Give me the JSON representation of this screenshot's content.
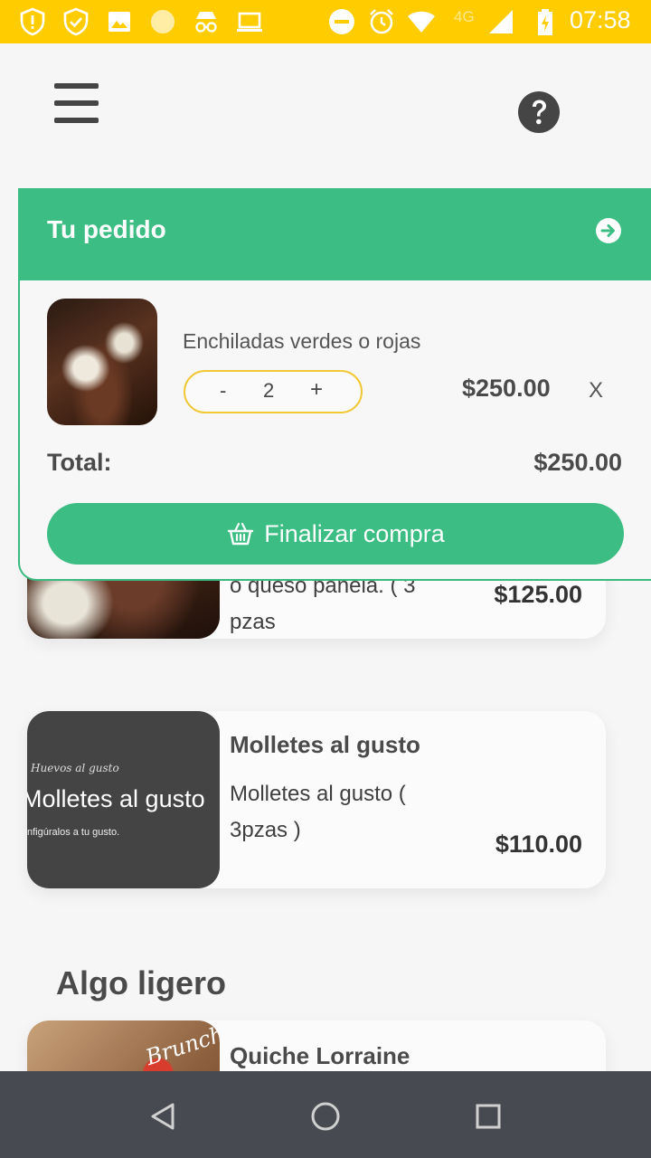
{
  "status_bar": {
    "time": "07:58",
    "network": "4G",
    "icons": [
      "alert-shield-icon",
      "check-shield-icon",
      "image-icon",
      "sun-icon",
      "incognito-icon",
      "laptop-icon",
      "do-not-disturb-icon",
      "alarm-icon",
      "wifi-icon",
      "signal-icon",
      "battery-charging-icon"
    ],
    "background_color": "#ffcc00"
  },
  "header": {
    "menu_icon": "hamburger-menu-icon",
    "help_icon": "help-question-icon"
  },
  "order": {
    "title": "Tu pedido",
    "header_color": "#3cbd83",
    "items": [
      {
        "name": "Enchiladas verdes o rojas",
        "quantity": "2",
        "minus_label": "-",
        "plus_label": "+",
        "price": "$250.00",
        "remove_label": "X"
      }
    ],
    "total_label": "Total:",
    "total_value": "$250.00",
    "checkout_label": "Finalizar compra",
    "checkout_icon": "basket-icon"
  },
  "products": [
    {
      "partial_desc_line1": "o queso panela. ( 3 pzas",
      "partial_desc_line2": ")",
      "price": "$125.00"
    },
    {
      "title": "Molletes al gusto",
      "desc_line1": "Molletes al gusto (",
      "desc_line2": "3pzas )",
      "price": "$110.00",
      "image_caption": "Huevos al gusto",
      "image_title": "Molletes al gusto",
      "image_subtitle": "nfigúralos a tu gusto."
    }
  ],
  "section": {
    "title": "Algo ligero",
    "first_item_title": "Quiche Lorraine",
    "first_item_image_caption": "Brunch"
  },
  "nav_bar": {
    "back_icon": "back-triangle-icon",
    "home_icon": "home-circle-icon",
    "recents_icon": "recents-square-icon"
  }
}
